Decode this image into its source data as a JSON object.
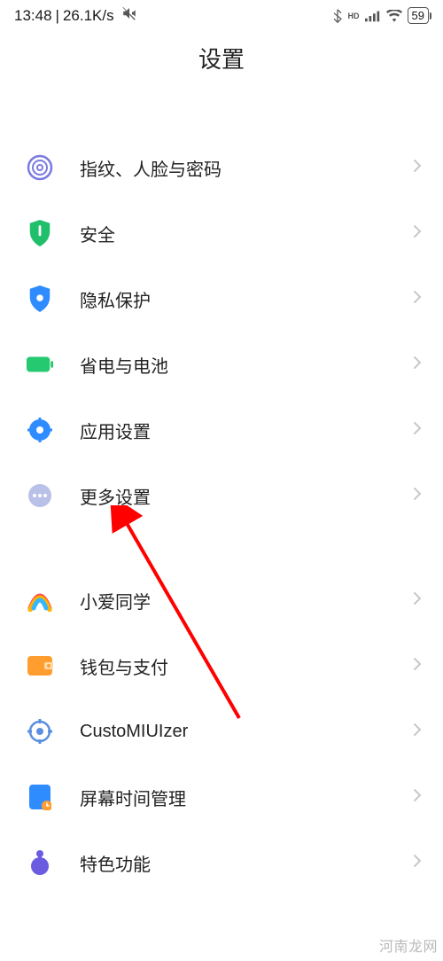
{
  "status": {
    "time": "13:48",
    "net_speed": "26.1K/s",
    "battery": "59"
  },
  "header": {
    "title": "设置"
  },
  "group1": [
    {
      "icon": "fingerprint-icon",
      "label": "指纹、人脸与密码"
    },
    {
      "icon": "shield-icon",
      "label": "安全"
    },
    {
      "icon": "privacy-icon",
      "label": "隐私保护"
    },
    {
      "icon": "battery-icon",
      "label": "省电与电池"
    },
    {
      "icon": "gear-icon",
      "label": "应用设置"
    },
    {
      "icon": "more-icon",
      "label": "更多设置"
    }
  ],
  "group2": [
    {
      "icon": "xiaoai-icon",
      "label": "小爱同学"
    },
    {
      "icon": "wallet-icon",
      "label": "钱包与支付"
    },
    {
      "icon": "customiuizer-icon",
      "label": "CustoMIUIzer"
    },
    {
      "icon": "screentime-icon",
      "label": "屏幕时间管理"
    },
    {
      "icon": "feature-icon",
      "label": "特色功能"
    }
  ],
  "watermark": "河南龙网"
}
